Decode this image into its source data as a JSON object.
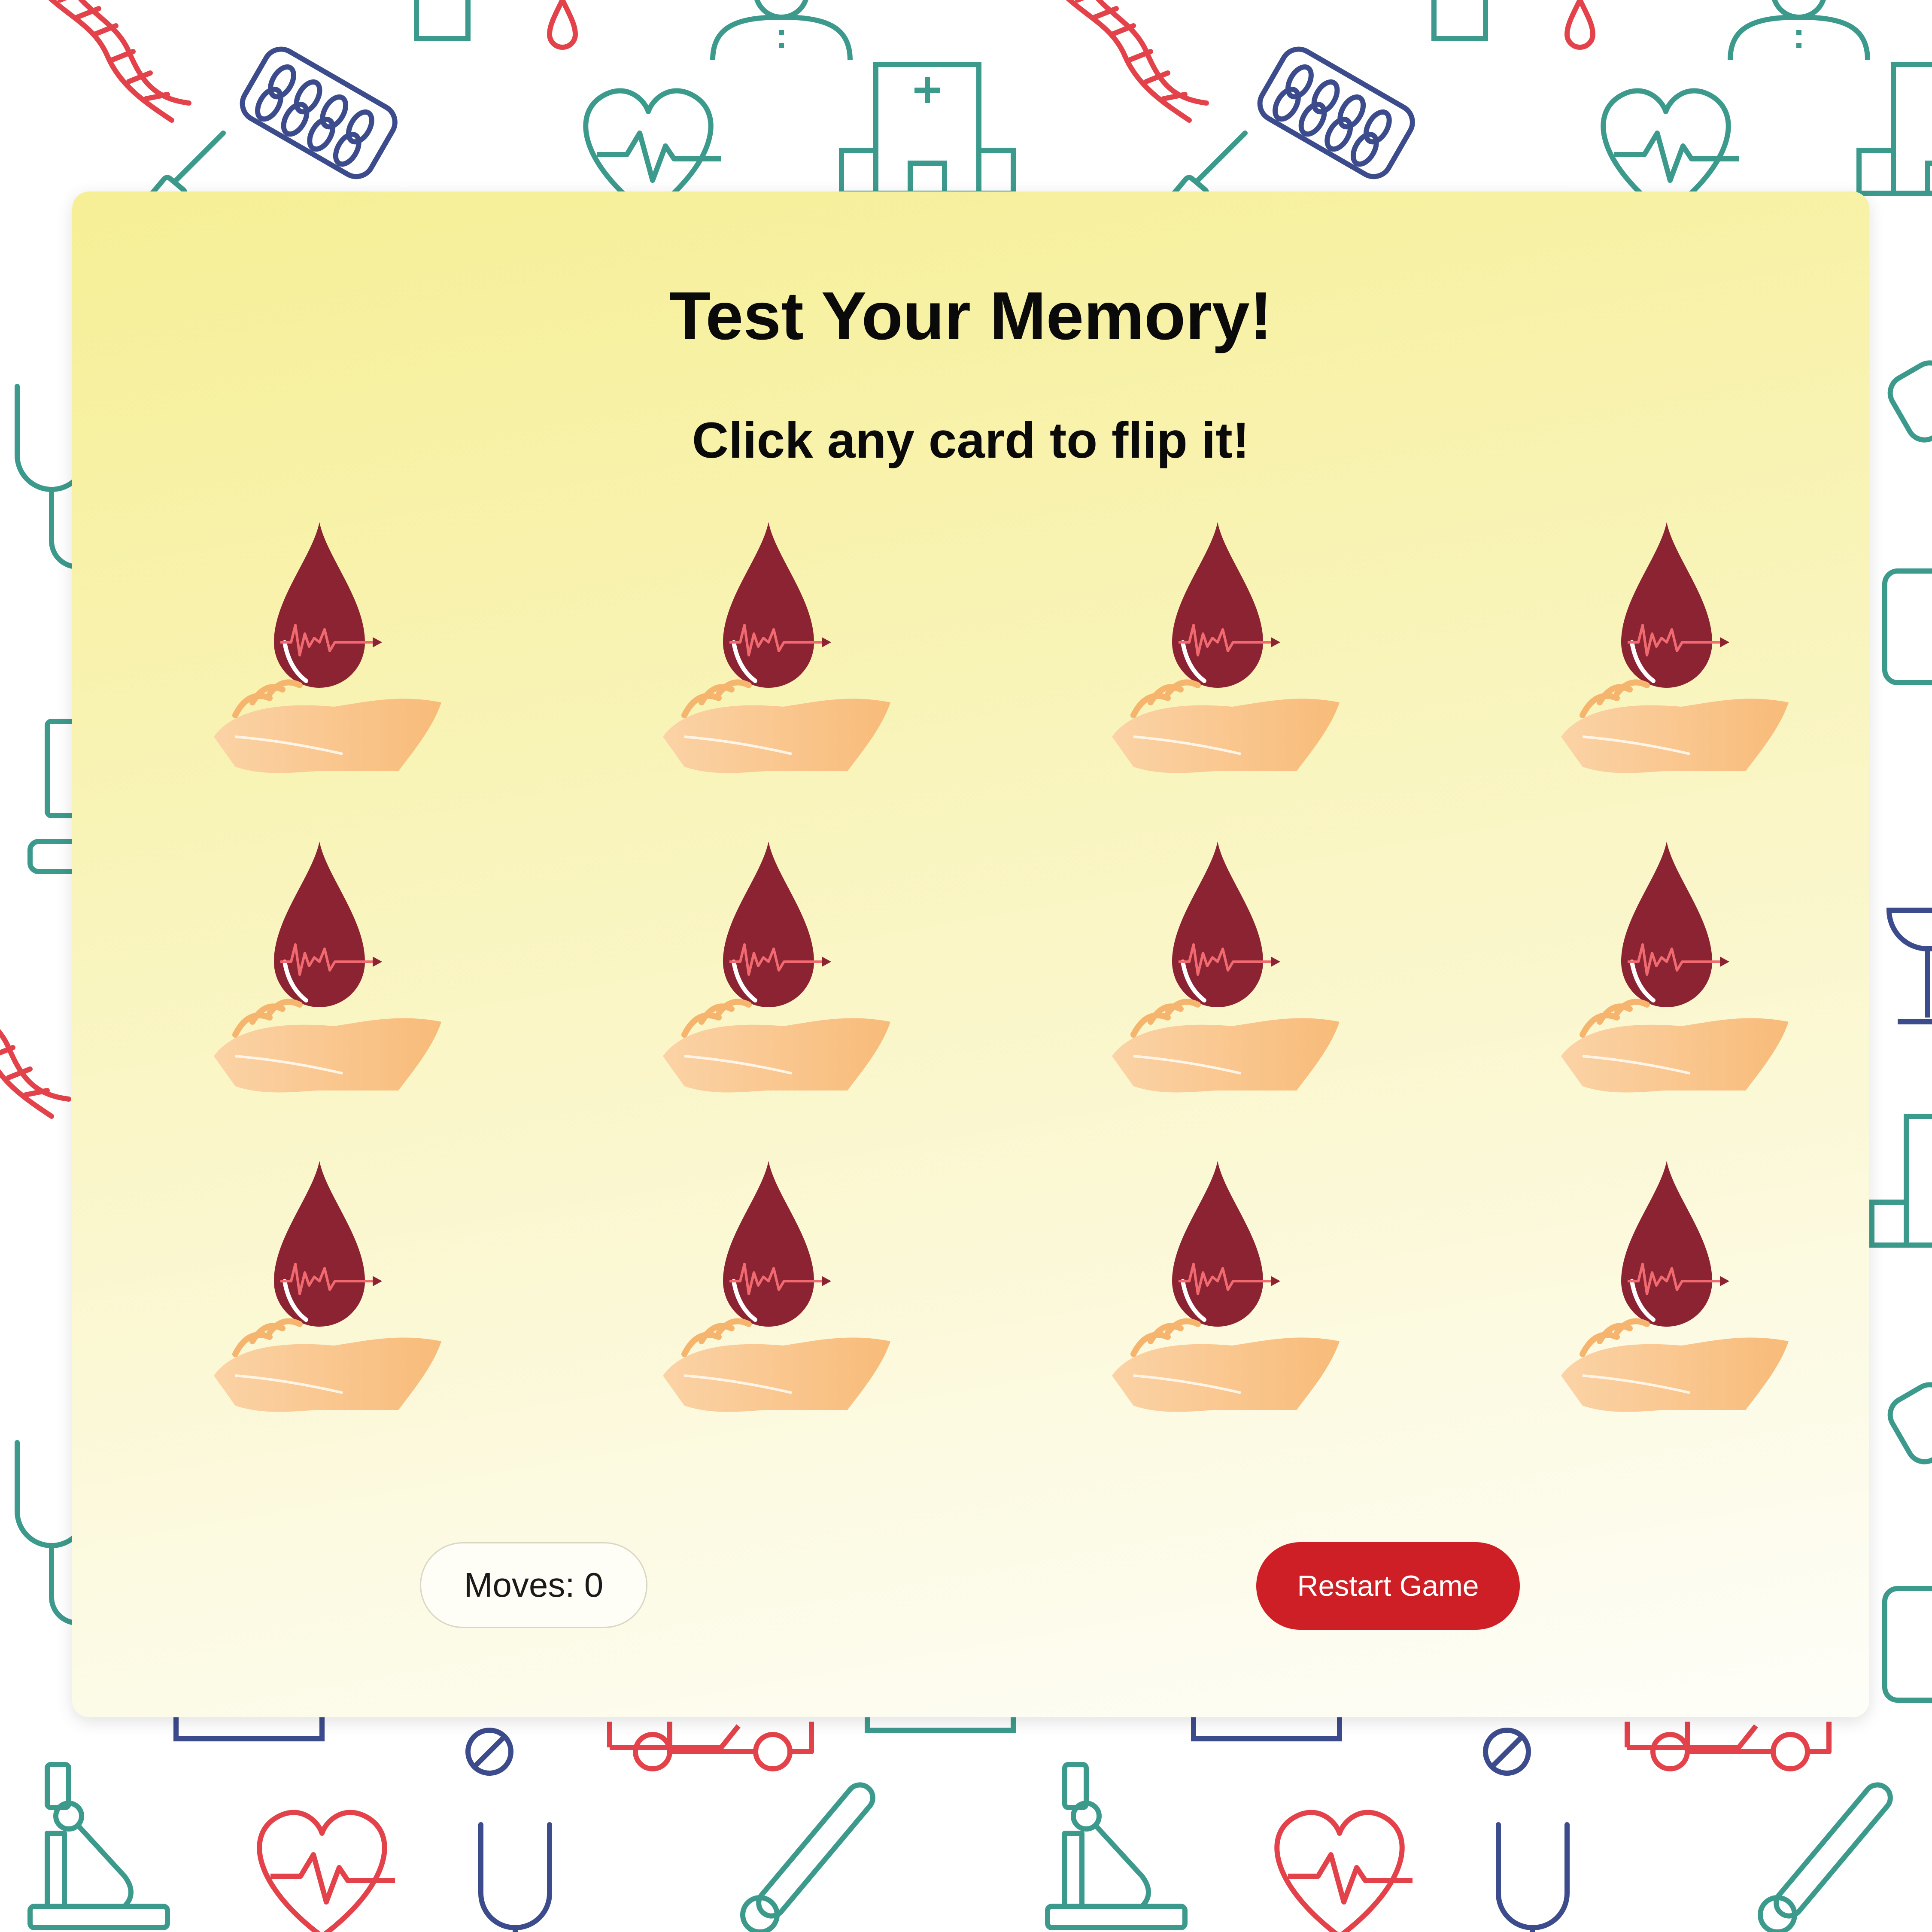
{
  "game": {
    "title": "Test Your Memory!",
    "instruction": "Click any card to flip it!",
    "moves_label": "Moves: 0",
    "moves_count": 0,
    "restart_label": "Restart Game"
  },
  "cards": {
    "rows": 3,
    "columns": 4,
    "state": "face-down",
    "back_icon": "blood-drop-on-hand-icon"
  },
  "colors": {
    "panel_gradient_top": "#f6ef96",
    "panel_gradient_bottom": "#fefef9",
    "restart_button": "#cd1f25",
    "blood_drop": "#8b2332",
    "hand": "#f8bb79",
    "pattern_teal": "#3c9a8c",
    "pattern_red": "#e3424a",
    "pattern_navy": "#3c4b8c"
  },
  "background_pattern_icons": [
    "dna-icon",
    "pill-pack-icon",
    "heart-pulse-icon",
    "hospital-icon",
    "syringe-icon",
    "doctor-icon",
    "stethoscope-icon",
    "microscope-icon",
    "thermometer-icon",
    "ambulance-icon",
    "blood-drop-icon",
    "bandage-icon"
  ]
}
